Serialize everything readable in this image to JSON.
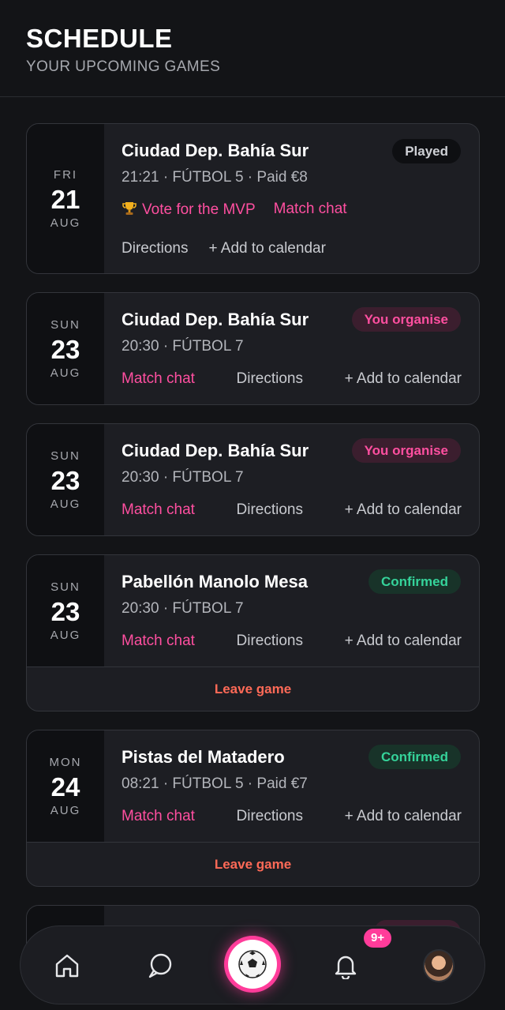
{
  "header": {
    "title": "SCHEDULE",
    "subtitle": "YOUR UPCOMING GAMES"
  },
  "games": [
    {
      "dow": "FRI",
      "day": "21",
      "month": "AUG",
      "venue": "Ciudad Dep. Bahía Sur",
      "meta": "21:21 · FÚTBOL 5 · Paid €8",
      "badge": "Played",
      "vote_mvp": "Vote for the MVP",
      "chat": "Match chat",
      "directions": "Directions",
      "calendar": "+ Add to calendar"
    },
    {
      "dow": "SUN",
      "day": "23",
      "month": "AUG",
      "venue": "Ciudad Dep. Bahía Sur",
      "meta": "20:30 · FÚTBOL 7",
      "badge": "You organise",
      "chat": "Match chat",
      "directions": "Directions",
      "calendar": "+ Add to calendar"
    },
    {
      "dow": "SUN",
      "day": "23",
      "month": "AUG",
      "venue": "Ciudad Dep. Bahía Sur",
      "meta": "20:30 · FÚTBOL 7",
      "badge": "You organise",
      "chat": "Match chat",
      "directions": "Directions",
      "calendar": "+ Add to calendar"
    },
    {
      "dow": "SUN",
      "day": "23",
      "month": "AUG",
      "venue": "Pabellón Manolo Mesa",
      "meta": "20:30 · FÚTBOL 7",
      "badge": "Confirmed",
      "chat": "Match chat",
      "directions": "Directions",
      "calendar": "+ Add to calendar",
      "leave": "Leave game"
    },
    {
      "dow": "MON",
      "day": "24",
      "month": "AUG",
      "venue": "Pistas del Matadero",
      "meta": "08:21 · FÚTBOL 5 · Paid €7",
      "badge": "Confirmed",
      "chat": "Match chat",
      "directions": "Directions",
      "calendar": "+ Add to calendar",
      "leave": "Leave game"
    }
  ],
  "nav": {
    "notification_count": "9+",
    "icons": [
      "home-icon",
      "chat-icon",
      "soccer-ball-icon",
      "bell-icon",
      "avatar"
    ]
  },
  "colors": {
    "accent": "#ff3c9a",
    "confirmed": "#35d39a",
    "leave": "#ff6a57",
    "background": "#131417",
    "card": "#1d1e23"
  }
}
